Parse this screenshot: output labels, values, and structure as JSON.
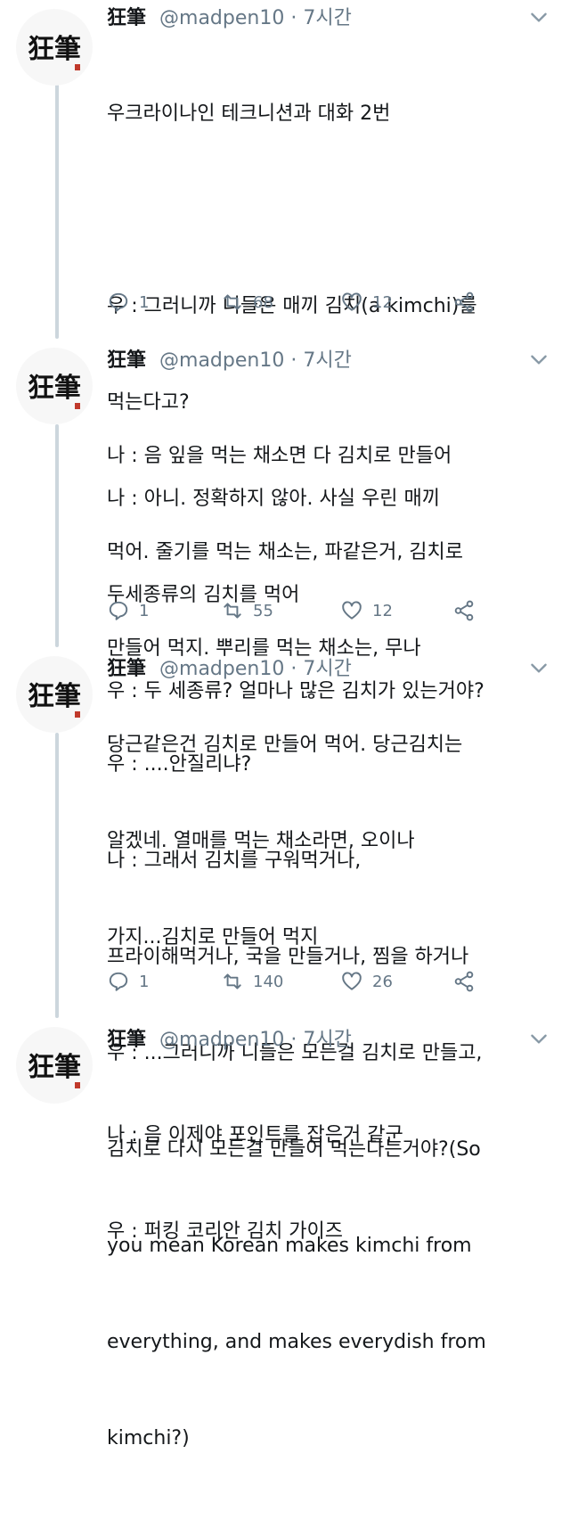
{
  "tweets": [
    {
      "name": "狂筆",
      "handle": "@madpen10",
      "dot": "·",
      "time": "7시간",
      "lines": [
        "우크라이나인 테크니션과 대화 2번",
        "",
        "우 : 그러니까 니들은 매끼 김치(a kimchi)를",
        "먹는다고?",
        "나 : 아니. 정확하지 않아. 사실 우린 매끼",
        "두세종류의 김치를 먹어",
        "우 : 두 세종류? 얼마나 많은 김치가 있는거야?"
      ],
      "replies": "1",
      "retweets": "68",
      "likes": "12"
    },
    {
      "name": "狂筆",
      "handle": "@madpen10",
      "dot": "·",
      "time": "7시간",
      "lines": [
        "나 : 음 잎을 먹는 채소면 다 김치로 만들어",
        "먹어. 줄기를 먹는 채소는, 파같은거, 김치로",
        "만들어 먹지. 뿌리를 먹는 채소는, 무나",
        "당근같은건 김치로 만들어 먹어. 당근김치는",
        "알겠네. 열매를 먹는 채소라면, 오이나",
        "가지...김치로 만들어 먹지"
      ],
      "replies": "1",
      "retweets": "55",
      "likes": "12"
    },
    {
      "name": "狂筆",
      "handle": "@madpen10",
      "dot": "·",
      "time": "7시간",
      "lines": [
        "우 : ....안질리냐?",
        "나 : 그래서 김치를 구워먹거나,",
        "프라이해먹거나, 국을 만들거나, 찜을 하거나",
        "우 : ...그러니까 니들은 모든걸 김치로 만들고,",
        "김치로 다시 모든걸 만들어 먹는다는거야?(So",
        "you mean Korean makes kimchi from",
        "everything, and makes everydish from",
        "kimchi?)"
      ],
      "replies": "1",
      "retweets": "140",
      "likes": "26"
    },
    {
      "name": "狂筆",
      "handle": "@madpen10",
      "dot": "·",
      "time": "7시간",
      "lines": [
        "나 : 음 이제야 포인트를 잡은거 같군",
        "우 : 퍼킹 코리안 김치 가이즈"
      ]
    }
  ],
  "avatar": {
    "glyphs": "狂筆",
    "ink_color": "#111111",
    "seal_color": "#c0392b",
    "bg_color": "#f7f7f7"
  },
  "colors": {
    "text": "#14171a",
    "secondary": "#657786",
    "thread_line": "#ccd6dd"
  },
  "icons": {
    "reply": "reply-icon",
    "retweet": "retweet-icon",
    "like": "heart-icon",
    "share": "share-icon",
    "more": "chevron-down-icon"
  }
}
